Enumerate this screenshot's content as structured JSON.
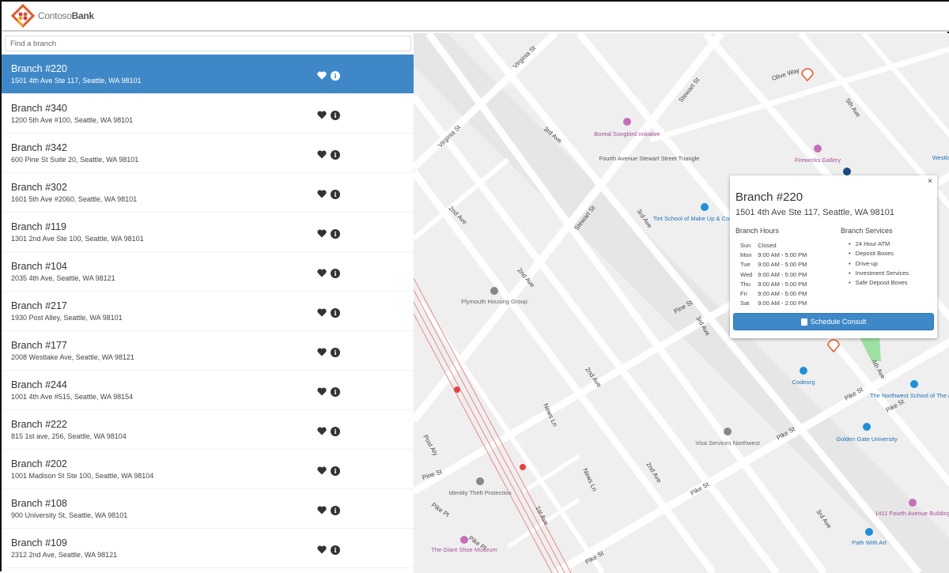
{
  "header": {
    "brand_light": "Contoso",
    "brand_bold": "Bank"
  },
  "search": {
    "placeholder": "Find a branch",
    "value": ""
  },
  "branches": [
    {
      "name": "Branch #220",
      "address": "1501 4th Ave Ste 117, Seattle, WA 98101",
      "selected": true
    },
    {
      "name": "Branch #340",
      "address": "1200 5th Ave #100, Seattle, WA 98101"
    },
    {
      "name": "Branch #342",
      "address": "600 Pine St Suite 20, Seattle, WA 98101"
    },
    {
      "name": "Branch #302",
      "address": "1601 5th Ave #2060, Seattle, WA 98101"
    },
    {
      "name": "Branch #119",
      "address": "1301 2nd Ave Ste 100, Seattle, WA 98101"
    },
    {
      "name": "Branch #104",
      "address": "2035 4th Ave, Seattle, WA 98121"
    },
    {
      "name": "Branch #217",
      "address": "1930 Post Alley, Seattle, WA 98101"
    },
    {
      "name": "Branch #177",
      "address": "2008 Westlake Ave, Seattle, WA 98121"
    },
    {
      "name": "Branch #244",
      "address": "1001 4th Ave #515, Seattle, WA 98154"
    },
    {
      "name": "Branch #222",
      "address": "815 1st ave, 256, Seattle, WA 98104"
    },
    {
      "name": "Branch #202",
      "address": "1001 Madison St Ste 100, Seattle, WA 98104"
    },
    {
      "name": "Branch #108",
      "address": "900 University St, Seattle, WA 98101"
    },
    {
      "name": "Branch #109",
      "address": "2312 2nd Ave, Seattle, WA 98121"
    }
  ],
  "popup": {
    "close": "×",
    "title": "Branch #220",
    "address": "1501 4th Ave Ste 117, Seattle, WA 98101",
    "hours_heading": "Branch Hours",
    "services_heading": "Branch Services",
    "hours": [
      {
        "day": "Sun",
        "time": "Closed"
      },
      {
        "day": "Mon",
        "time": "9:00 AM - 5:00 PM"
      },
      {
        "day": "Tue",
        "time": "9:00 AM - 5:00 PM"
      },
      {
        "day": "Wed",
        "time": "9:00 AM - 5:00 PM"
      },
      {
        "day": "Thu",
        "time": "9:00 AM - 5:00 PM"
      },
      {
        "day": "Fri",
        "time": "9:00 AM - 5:00 PM"
      },
      {
        "day": "Sat",
        "time": "9:00 AM - 2:00 PM"
      }
    ],
    "services": [
      "24 Hour ATM",
      "Deposit Boxes",
      "Drive-up",
      "Investment Services",
      "Safe Deposit Boxes"
    ],
    "button": "Schedule Consult"
  },
  "map": {
    "streets": [
      "Virginia St",
      "Virginia St",
      "Stewart St",
      "Stewart St",
      "Olive Way",
      "2nd Ave",
      "2nd Ave",
      "2nd Ave",
      "2nd Ave",
      "3rd Ave",
      "3rd Ave",
      "3rd Ave",
      "3rd Ave",
      "4th Ave",
      "5th Ave",
      "Pine St",
      "Pine St",
      "Pike St",
      "Pike St",
      "Pike St",
      "Pike St",
      "1st Ave",
      "News Ln",
      "News Ln",
      "Post Aly",
      "Pike Pl",
      "Pike Pl",
      "Pike St"
    ],
    "pois": [
      "Boreal Songbird Initiative",
      "Fourth Avenue Stewart Street Triangle",
      "Fireworks Gallery",
      "Tint School of Make Up & Cosmetology",
      "Plymouth Housing Group",
      "Codeorg",
      "The Northwest School of The Arts",
      "Golden Gate University",
      "Visa Services Northwest",
      "Identity Theft Protection",
      "1411 Fourth Avenue Building",
      "Path With Art",
      "The Giant Shoe Museum",
      "Westlake Link"
    ]
  },
  "colors": {
    "accent": "#3f88c8",
    "poi_purple": "#a5509b",
    "poi_blue": "#1f74b8"
  }
}
